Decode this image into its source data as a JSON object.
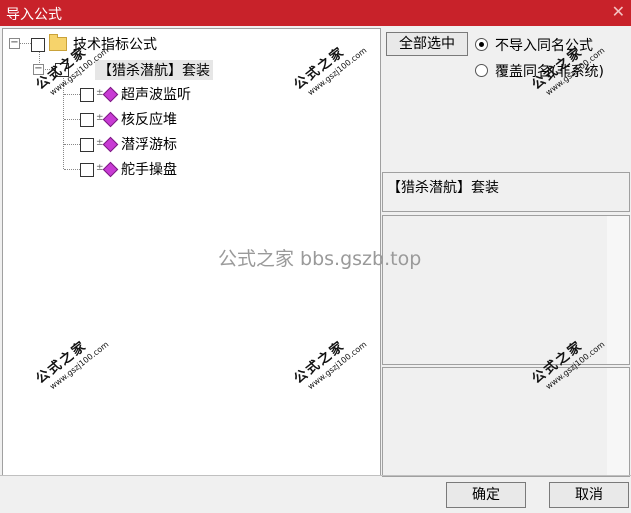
{
  "window": {
    "title": "导入公式",
    "close_glyph": "✕"
  },
  "tree": {
    "root": {
      "expander": "−",
      "label": "技术指标公式",
      "checked": false
    },
    "package": {
      "expander": "−",
      "label": "【猎杀潜航】套装",
      "checked": false
    },
    "items": [
      {
        "label": "超声波监听",
        "checked": false
      },
      {
        "label": "核反应堆",
        "checked": false
      },
      {
        "label": "潜浮游标",
        "checked": false
      },
      {
        "label": "舵手操盘",
        "checked": false
      }
    ],
    "item_prefix": "±"
  },
  "buttons": {
    "select_all": "全部选中",
    "ok": "确定",
    "cancel": "取消"
  },
  "options": {
    "skip_same_name": "不导入同名公式",
    "overwrite_same_name": "覆盖同名(非系统)",
    "selected": "skip_same_name"
  },
  "description": {
    "text": "【猎杀潜航】套装"
  },
  "watermarks": {
    "brand": "公式之家",
    "url": "www.gszj100.com",
    "center": "公式之家 bbs.gszb.top"
  },
  "colors": {
    "titlebar": "#c8222a",
    "formula_icon": "#c83bd4"
  },
  "icons": {
    "folder": "folder-icon",
    "formula": "formula-icon"
  }
}
